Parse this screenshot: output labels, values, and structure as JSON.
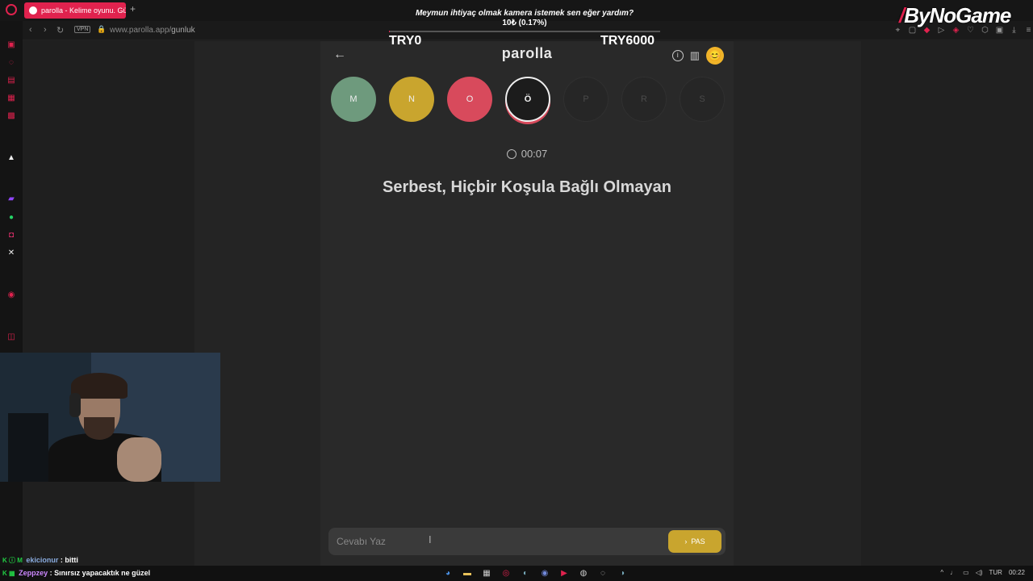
{
  "browser": {
    "tab_title": "parolla - Kelime oyunu. Gü",
    "new_tab": "+",
    "vpn_label": "VPN",
    "url_host": "www.parolla.app/",
    "url_path": "gunluk"
  },
  "game": {
    "title": "parolla",
    "back": "←",
    "info": "i",
    "stats": "▥",
    "avatar": "😊",
    "letters": [
      {
        "letter": "M",
        "state": "correct"
      },
      {
        "letter": "N",
        "state": "passed"
      },
      {
        "letter": "O",
        "state": "wrong"
      },
      {
        "letter": "Ö",
        "state": "active"
      },
      {
        "letter": "P",
        "state": "pending"
      },
      {
        "letter": "R",
        "state": "pending"
      },
      {
        "letter": "S",
        "state": "pending"
      }
    ],
    "timer": "00:07",
    "question": "Serbest, Hiçbir Koşula Bağlı Olmayan",
    "answer_placeholder": "Cevabı Yaz",
    "pass_label": "PAS",
    "pass_chevron": "›"
  },
  "overlay": {
    "donation_message": "Meymun ihtiyaç olmak kamera istemek sen eğer yardım?",
    "donation_amount": "10₺ (0.17%)",
    "donation_progress": 0.17,
    "goal_left": "TRY0",
    "goal_right": "TRY6000",
    "logo_text": "ByNoGame"
  },
  "chat": [
    {
      "badges": "K ⓘ M",
      "user": "ekicionur",
      "message": " : bitti"
    },
    {
      "badges": "K ▦",
      "user": "Zeppzey",
      "message": " : Sınırsız yapacaktık ne güzel"
    }
  ],
  "taskbar": {
    "lang": "TUR",
    "time": "00:22"
  },
  "colors": {
    "accent": "#e0224e",
    "correct": "#6e9a7d",
    "passed": "#c9a52e",
    "wrong": "#d84a5c"
  }
}
